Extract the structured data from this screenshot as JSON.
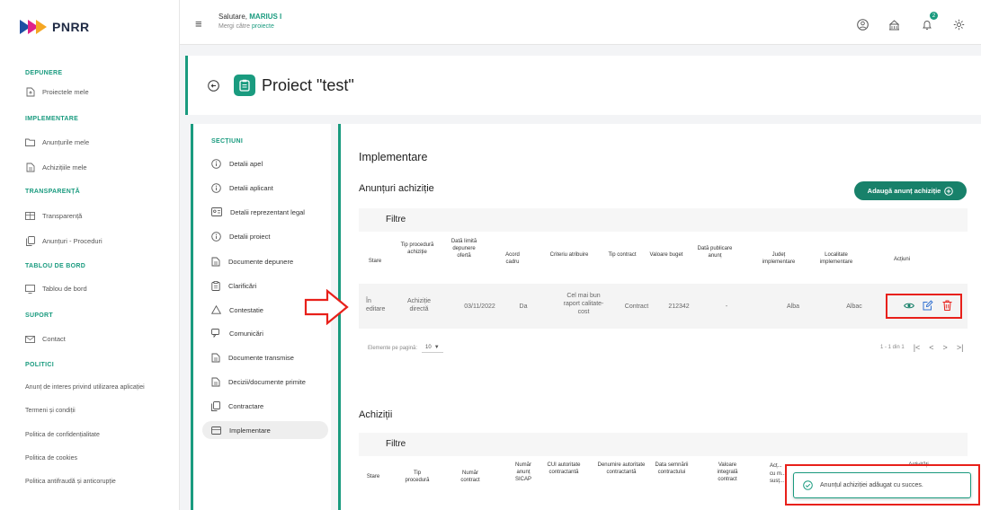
{
  "app": {
    "logo": "PNRR"
  },
  "sidebar": {
    "sections": [
      "DEPUNERE",
      "IMPLEMENTARE",
      "TRANSPARENȚĂ",
      "TABLOU DE BORD",
      "SUPORT",
      "POLITICI"
    ],
    "items": {
      "proiecte": "Proiectele mele",
      "anunturi": "Anunțurile mele",
      "achizitii": "Achizițiile mele",
      "transparenta": "Transparență",
      "anunturi_proceduri": "Anunțuri - Proceduri",
      "tablou": "Tablou de bord",
      "contact": "Contact"
    },
    "politici": [
      "Anunț de interes privind utilizarea aplicației",
      "Termeni și condiții",
      "Politica de confidențialitate",
      "Politica de cookies",
      "Politica antifraudă și anticorupție"
    ]
  },
  "topbar": {
    "greeting_prefix": "Salutare, ",
    "user": "MARIUS I",
    "goto_prefix": "Mergi către ",
    "goto_link": "proiecte",
    "notif_count": "2"
  },
  "project": {
    "title": "Proiect \"test\""
  },
  "sections": {
    "title": "SECȚIUNI",
    "items": [
      "Detalii apel",
      "Detalii aplicant",
      "Detalii reprezentant legal",
      "Detalii proiect",
      "Documente depunere",
      "Clarificări",
      "Contestatie",
      "Comunicări",
      "Documente transmise",
      "Decizii/documente primite",
      "Contractare",
      "Implementare"
    ],
    "active_index": 11
  },
  "main": {
    "heading": "Implementare",
    "anunturi_title": "Anunțuri achiziție",
    "add_button": "Adaugă anunț achiziție",
    "filter_label": "Filtre",
    "columns": [
      "Stare",
      "Tip procedură achiziție",
      "Dată limită depunere ofertă",
      "Acord cadru",
      "Criteriu atribuire",
      "Tip contract",
      "Valoare buget",
      "Dată publicare anunț",
      "Județ implementare",
      "Localitate implementare",
      "Acțiuni"
    ],
    "row": {
      "stare": "În editare",
      "tip_procedura": "Achiziție directă",
      "data_limita": "03/11/2022",
      "acord_cadru": "Da",
      "criteriu": "Cel mai bun raport calitate-cost",
      "tip_contract": "Contract",
      "valoare": "212342",
      "data_publicare": "-",
      "judet": "Alba",
      "localitate": "Albac"
    },
    "pagination": {
      "per_page_label": "Elemente pe pagină:",
      "per_page_value": "10",
      "range": "1 - 1 din 1"
    },
    "achizitii_title": "Achiziții",
    "achizitii_filter": "Filtre",
    "achizitii_columns": [
      "Stare",
      "Tip procedură",
      "Număr contract",
      "Număr anunț SICAP",
      "CUI autoritate contractantă",
      "Denumire autoritate contractantă",
      "Data semnării contractului",
      "Valoare integrală contract"
    ],
    "achizitii_col_partial": [
      "Acț...",
      "cu m...",
      "susț..."
    ],
    "achizitii_col_partial2": "Activități..."
  },
  "toast": {
    "message": "Anunțul achiziției adăugat cu succes."
  },
  "colors": {
    "accent": "#1a9b7f",
    "button": "#18816a",
    "highlight": "#e8201a"
  }
}
